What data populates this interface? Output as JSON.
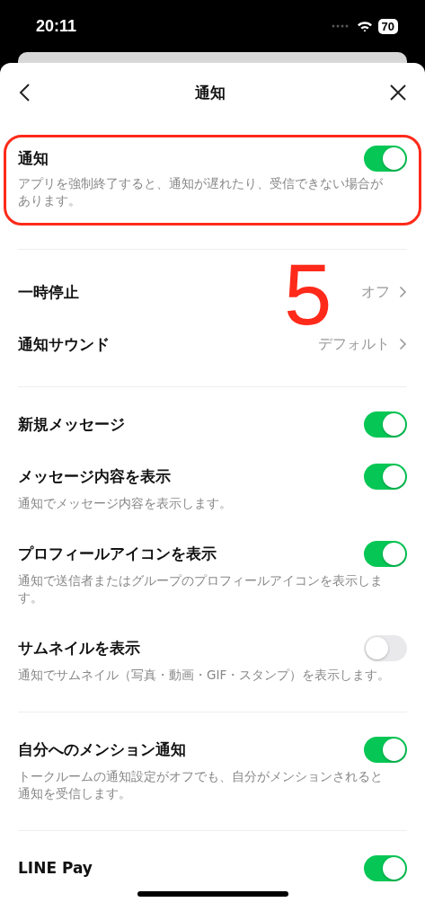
{
  "status_bar": {
    "time": "20:11",
    "battery": "70"
  },
  "header": {
    "title": "通知"
  },
  "annotation": {
    "step_number": "5"
  },
  "sections": [
    {
      "highlighted": true,
      "items": [
        {
          "kind": "toggle",
          "label": "通知",
          "on": true,
          "description": "アプリを強制終了すると、通知が遅れたり、受信できない場合があります。"
        }
      ]
    },
    {
      "highlighted": false,
      "items": [
        {
          "kind": "link",
          "label": "一時停止",
          "value": "オフ"
        },
        {
          "kind": "link",
          "label": "通知サウンド",
          "value": "デフォルト"
        }
      ]
    },
    {
      "highlighted": false,
      "items": [
        {
          "kind": "toggle",
          "label": "新規メッセージ",
          "on": true
        },
        {
          "kind": "toggle",
          "label": "メッセージ内容を表示",
          "on": true,
          "description": "通知でメッセージ内容を表示します。"
        },
        {
          "kind": "toggle",
          "label": "プロフィールアイコンを表示",
          "on": true,
          "description": "通知で送信者またはグループのプロフィールアイコンを表示します。"
        },
        {
          "kind": "toggle",
          "label": "サムネイルを表示",
          "on": false,
          "description": "通知でサムネイル（写真・動画・GIF・スタンプ）を表示します。"
        }
      ]
    },
    {
      "highlighted": false,
      "items": [
        {
          "kind": "toggle",
          "label": "自分へのメンション通知",
          "on": true,
          "description": "トークルームの通知設定がオフでも、自分がメンションされると通知を受信します。"
        }
      ]
    },
    {
      "highlighted": false,
      "items": [
        {
          "kind": "toggle",
          "label": "LINE Pay",
          "on": true
        }
      ]
    }
  ]
}
